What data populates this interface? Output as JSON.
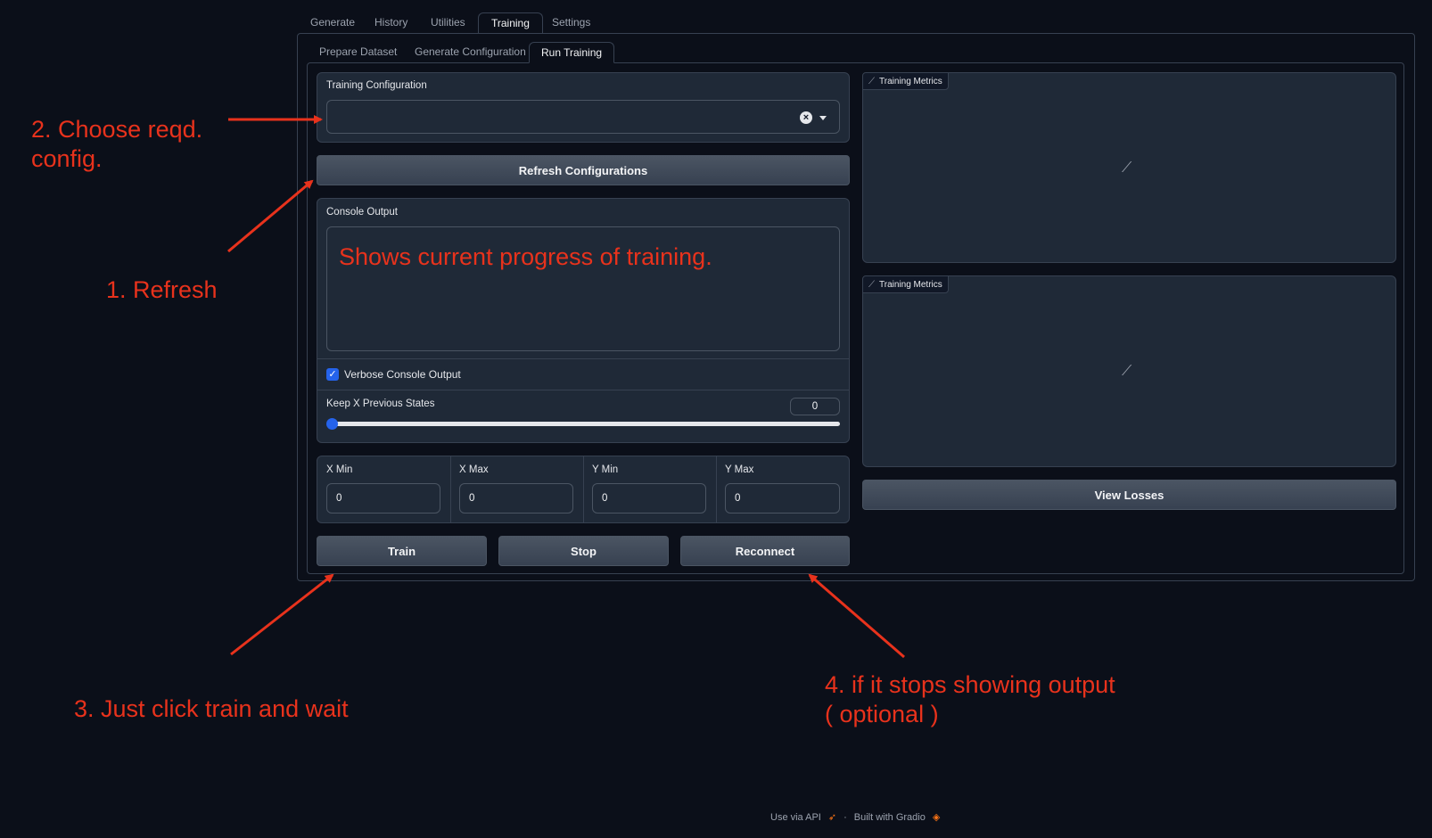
{
  "tabs": [
    "Generate",
    "History",
    "Utilities",
    "Training",
    "Settings"
  ],
  "active_tab": "Training",
  "subtabs": [
    "Prepare Dataset",
    "Generate Configuration",
    "Run Training"
  ],
  "active_subtab": "Run Training",
  "training_config": {
    "label": "Training Configuration",
    "value": ""
  },
  "refresh_button": "Refresh Configurations",
  "console": {
    "label": "Console Output",
    "text": "Shows current progress of training."
  },
  "verbose": {
    "label": "Verbose Console Output",
    "checked": true
  },
  "keep_states": {
    "label": "Keep X Previous States",
    "value": "0"
  },
  "ranges": [
    {
      "label": "X Min",
      "value": "0"
    },
    {
      "label": "X Max",
      "value": "0"
    },
    {
      "label": "Y Min",
      "value": "0"
    },
    {
      "label": "Y Max",
      "value": "0"
    }
  ],
  "buttons": {
    "train": "Train",
    "stop": "Stop",
    "reconnect": "Reconnect",
    "view_losses": "View Losses"
  },
  "metrics": [
    {
      "label": "Training Metrics"
    },
    {
      "label": "Training Metrics"
    }
  ],
  "annotations": {
    "refresh": "1. Refresh",
    "choose_line1": "2. Choose reqd.",
    "choose_line2": "config.",
    "train": "3. Just click train and wait",
    "reconnect_line1": "4. if it stops showing output",
    "reconnect_line2": "( optional )"
  },
  "footer": {
    "api": "Use via API",
    "separator": "·",
    "built": "Built with Gradio"
  },
  "colors": {
    "background": "#0b0f19",
    "annotation": "#e8321c",
    "checkbox": "#2563eb",
    "slider": "#2563eb"
  }
}
